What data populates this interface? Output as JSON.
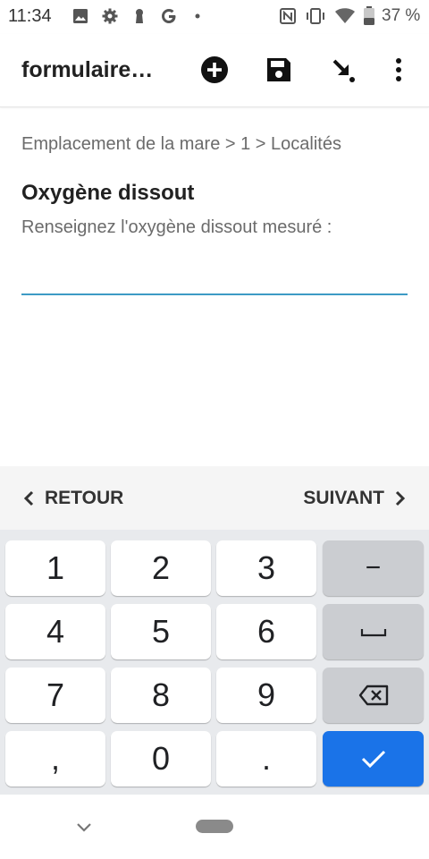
{
  "status_bar": {
    "time": "11:34",
    "battery_text": "37 %",
    "icons_left": [
      "image-icon",
      "settings-icon",
      "keyhole-icon",
      "google-icon",
      "dot-icon"
    ],
    "icons_right": [
      "nfc-icon",
      "vibrate-icon",
      "wifi-icon",
      "battery-icon"
    ]
  },
  "app_bar": {
    "title": "formulaire…",
    "actions": [
      "add-repeat-icon",
      "save-icon",
      "jump-icon",
      "more-vert-icon"
    ]
  },
  "content": {
    "breadcrumb": "Emplacement de la mare > 1 > Localités",
    "question_title": "Oxygène dissout",
    "question_hint": "Renseignez l'oxygène dissout mesuré :",
    "answer_value": "",
    "accent_color": "#3d9ac5"
  },
  "navigation": {
    "prev_label": "RETOUR",
    "next_label": "SUIVANT"
  },
  "keyboard": {
    "rows": [
      [
        "1",
        "2",
        "3",
        "−"
      ],
      [
        "4",
        "5",
        "6",
        "space"
      ],
      [
        "7",
        "8",
        "9",
        "backspace"
      ],
      [
        ",",
        "0",
        ".",
        "done"
      ]
    ],
    "labels": {
      "k1": "1",
      "k2": "2",
      "k3": "3",
      "minus": "−",
      "k4": "4",
      "k5": "5",
      "k6": "6",
      "k7": "7",
      "k8": "8",
      "k9": "9",
      "comma": ",",
      "k0": "0",
      "dot": "."
    },
    "action_color": "#1a73e8"
  }
}
